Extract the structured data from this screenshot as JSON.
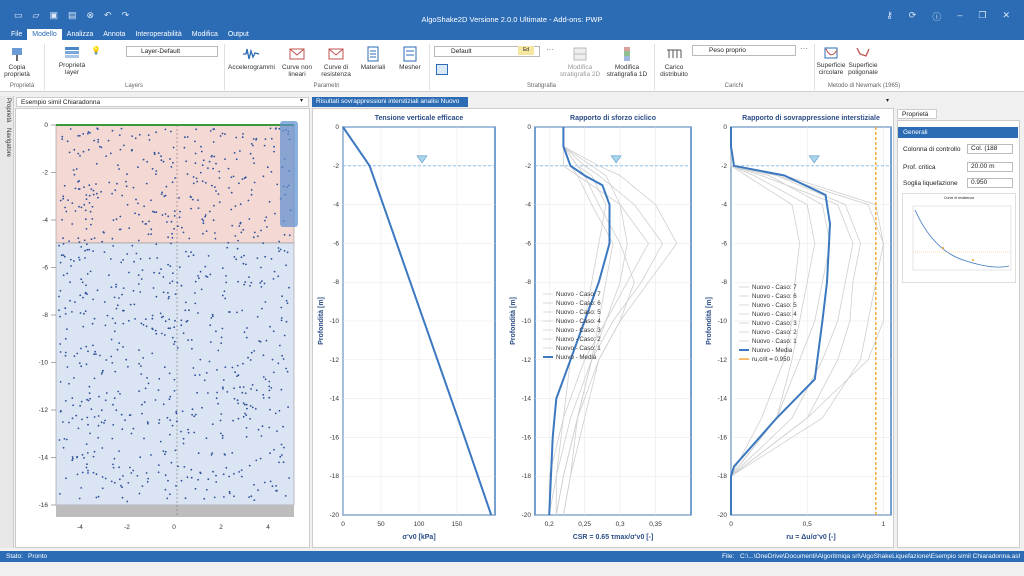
{
  "app": {
    "title": "AlgoShake2D Versione 2.0.0 Ultimate - Add-ons: PWP"
  },
  "menu": [
    {
      "label": "File"
    },
    {
      "label": "Modello"
    },
    {
      "label": "Analizza"
    },
    {
      "label": "Annota"
    },
    {
      "label": "Interoperabilità"
    },
    {
      "label": "Modifica"
    },
    {
      "label": "Output"
    }
  ],
  "ribbon": {
    "copia": "Copia proprietà",
    "proprieta_layer": "Proprietà layer",
    "layer_combo": "Layer-Default",
    "accelerogrammi": "Accelerogrammi",
    "curve_non_lineari": "Curve non lineari",
    "curve_resistenza": "Curve di resistenza",
    "materiali": "Materiali",
    "mesher": "Mesher",
    "strat_combo": "Default",
    "modifica_2d": "Modifica stratigrafia 2D",
    "modifica_1d": "Modifica stratigrafia 1D",
    "carico_distribuito": "Carico distribuito",
    "peso_combo": "Peso proprio",
    "superficie_circolare": "Superficie circolare",
    "superficie_poligonale": "Superficie poligonale",
    "groups": {
      "proprieta": "Proprietà",
      "layers": "Layers",
      "parametri": "Parametri",
      "stratigrafia": "Stratigrafia",
      "carichi": "Carichi",
      "newmark": "Metodo di Newmark (1965)"
    }
  },
  "side_strip": {
    "proprieta": "Proprietà",
    "navigatore": "Navigatore"
  },
  "tabs": {
    "model_tab": "Esempio simil Chiaradonna",
    "results_tab": "Risultati sovrappressioni interstiziali analisi Nuovo",
    "props_tab": "Proprietà"
  },
  "model_view": {
    "y_ticks": [
      "0",
      "-2",
      "-4",
      "-6",
      "-8",
      "-10",
      "-12",
      "-14",
      "-16"
    ],
    "x_ticks": [
      "-4",
      "-2",
      "0",
      "2",
      "4"
    ]
  },
  "charts": {
    "c1": {
      "title": "Tensione verticale efficace",
      "xlabel": "σ'v0 [kPa]",
      "ylabel": "Profondità [m]",
      "x_ticks": [
        "0",
        "50",
        "100",
        "150"
      ],
      "y_ticks": [
        "0",
        "-2",
        "-4",
        "-6",
        "-8",
        "-10",
        "-12",
        "-14",
        "-16",
        "-18",
        "-20"
      ]
    },
    "c2": {
      "title": "Rapporto di sforzo ciclico",
      "xlabel": "CSR = 0.65 τmax/σ'v0 [-]",
      "ylabel": "Profondità [m]",
      "x_ticks": [
        "0,2",
        "0,25",
        "0,3",
        "0,35"
      ],
      "y_ticks": [
        "0",
        "-2",
        "-4",
        "-6",
        "-8",
        "-10",
        "-12",
        "-14",
        "-16",
        "-18",
        "-20"
      ],
      "legend": [
        "Nuovo - Caso: 7",
        "Nuovo - Caso: 6",
        "Nuovo - Caso: 5",
        "Nuovo - Caso: 4",
        "Nuovo - Caso: 3",
        "Nuovo - Caso: 2",
        "Nuovo - Caso: 1",
        "Nuovo - Media"
      ]
    },
    "c3": {
      "title": "Rapporto di sovrappressione interstiziale",
      "xlabel": "ru = Δu/σ'v0 [-]",
      "ylabel": "Profondità [m]",
      "x_ticks": [
        "0",
        "0,5",
        "1"
      ],
      "y_ticks": [
        "0",
        "-2",
        "-4",
        "-6",
        "-8",
        "-10",
        "-12",
        "-14",
        "-16",
        "-18",
        "-20"
      ],
      "legend": [
        "Nuovo - Caso: 7",
        "Nuovo - Caso: 6",
        "Nuovo - Caso: 5",
        "Nuovo - Caso: 4",
        "Nuovo - Caso: 3",
        "Nuovo - Caso: 2",
        "Nuovo - Caso: 1",
        "Nuovo - Media",
        "ru,crit = 0,950"
      ]
    }
  },
  "chart_data": [
    {
      "type": "line",
      "title": "Tensione verticale efficace",
      "xlabel": "σ'v0 [kPa]",
      "ylabel": "Profondità [m]",
      "xlim": [
        0,
        200
      ],
      "ylim": [
        -20,
        0
      ],
      "series": [
        {
          "x": [
            0,
            35,
            160,
            195
          ],
          "y": [
            0,
            -2,
            -16,
            -20
          ]
        }
      ]
    },
    {
      "type": "line",
      "title": "Rapporto di sforzo ciclico",
      "xlabel": "CSR = 0.65 τmax/σ'v0 [-]",
      "ylabel": "Profondità [m]",
      "xlim": [
        0.18,
        0.4
      ],
      "ylim": [
        -20,
        0
      ],
      "series": [
        {
          "name": "Nuovo - Media",
          "x": [
            0.22,
            0.22,
            0.23,
            0.25,
            0.275,
            0.285,
            0.285,
            0.27,
            0.25,
            0.23,
            0.21,
            0.205,
            0.2
          ],
          "y": [
            0,
            -1,
            -2,
            -2.5,
            -3,
            -4,
            -6,
            -8,
            -10,
            -12,
            -14,
            -16,
            -20
          ]
        }
      ]
    },
    {
      "type": "line",
      "title": "Rapporto di sovrappressione interstiziale",
      "xlabel": "ru = Δu/σ'v0 [-]",
      "ylabel": "Profondità [m]",
      "xlim": [
        0,
        1.05
      ],
      "ylim": [
        -20,
        0
      ],
      "series": [
        {
          "name": "Nuovo - Media",
          "x": [
            0,
            0,
            0.02,
            0.35,
            0.62,
            0.65,
            0.63,
            0.6,
            0.55,
            0.3,
            0.02,
            0,
            0
          ],
          "y": [
            0,
            -1,
            -2,
            -2.5,
            -3.5,
            -5,
            -8,
            -10,
            -13,
            -15,
            -17.5,
            -18,
            -20
          ]
        },
        {
          "name": "ru,crit = 0,950",
          "x": [
            0.95,
            0.95
          ],
          "y": [
            0,
            -20
          ]
        }
      ]
    }
  ],
  "properties": {
    "header": "Generali",
    "rows": [
      {
        "label": "Colonna di controllo",
        "value": "Col. (188"
      },
      {
        "label": "Prof. critica",
        "value": "20.00 m"
      },
      {
        "label": "Soglia liquefazione",
        "value": "0.950"
      }
    ],
    "thumb_title": "Curve di resistenza"
  },
  "status": {
    "label": "Stato:",
    "value": "Pronto",
    "file_label": "File:",
    "file_path": "C:\\...\\OneDrive\\Documenti\\Algoritmiqa srl\\AlgoShakeLiquefazione\\Esempio simil Chiaradonna.ash"
  },
  "colors": {
    "accent": "#2b6cb5",
    "media": "#3b78c0",
    "crit": "#f0a020"
  }
}
